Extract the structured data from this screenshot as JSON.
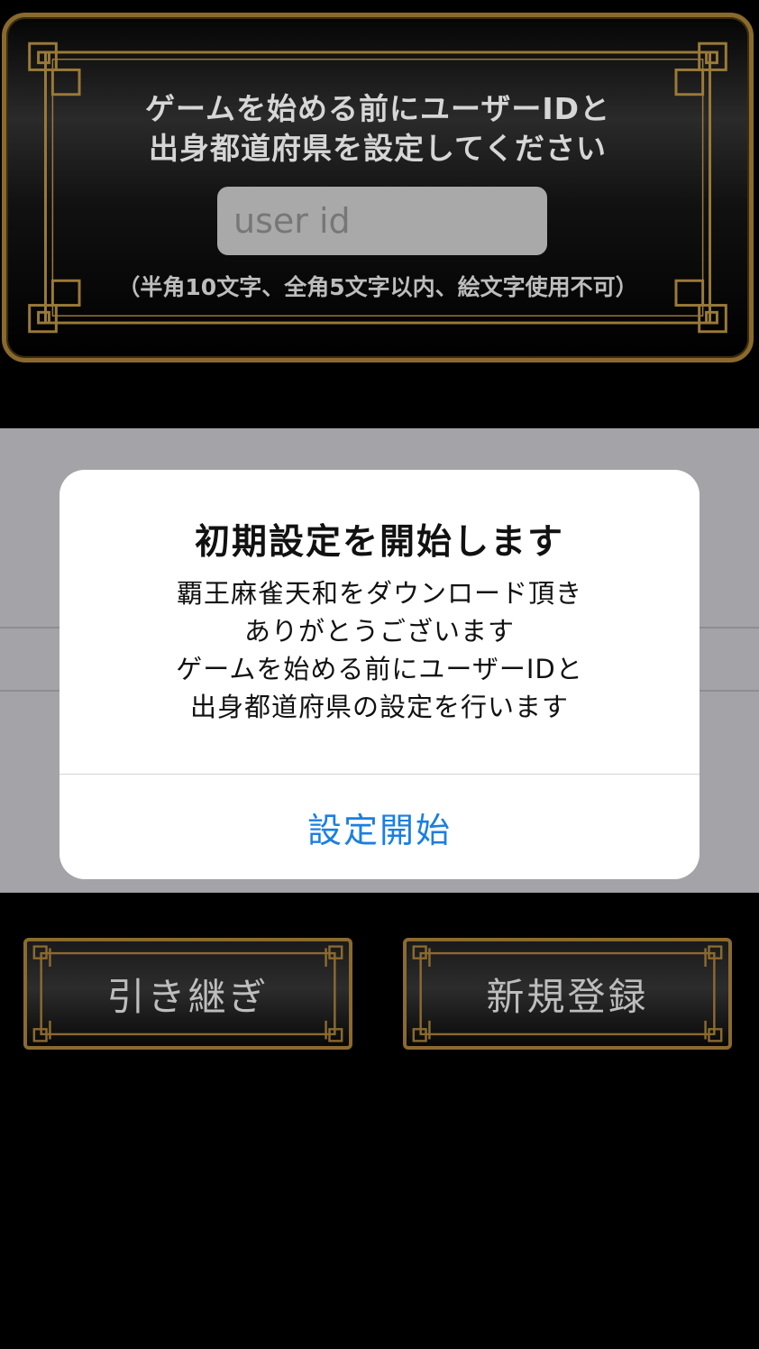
{
  "top_panel": {
    "title_line1": "ゲームを始める前にユーザーIDと",
    "title_line2": "出身都道府県を設定してください",
    "user_id_placeholder": "user id",
    "user_id_value": "",
    "note": "（半角10文字、全角5文字以内、絵文字使用不可）"
  },
  "alert": {
    "title": "初期設定を開始します",
    "message_lines": [
      "覇王麻雀天和をダウンロード頂き",
      "ありがとうございます",
      "ゲームを始める前にユーザーIDと",
      "出身都道府県の設定を行います"
    ],
    "button_label": "設定開始",
    "button_color": "#1a7fe0"
  },
  "buttons": {
    "transfer_label": "引き継ぎ",
    "register_label": "新規登録"
  },
  "colors": {
    "background": "#000000",
    "frame_gold": "#8a6a2c",
    "backdrop_grey": "#a4a3a8"
  }
}
